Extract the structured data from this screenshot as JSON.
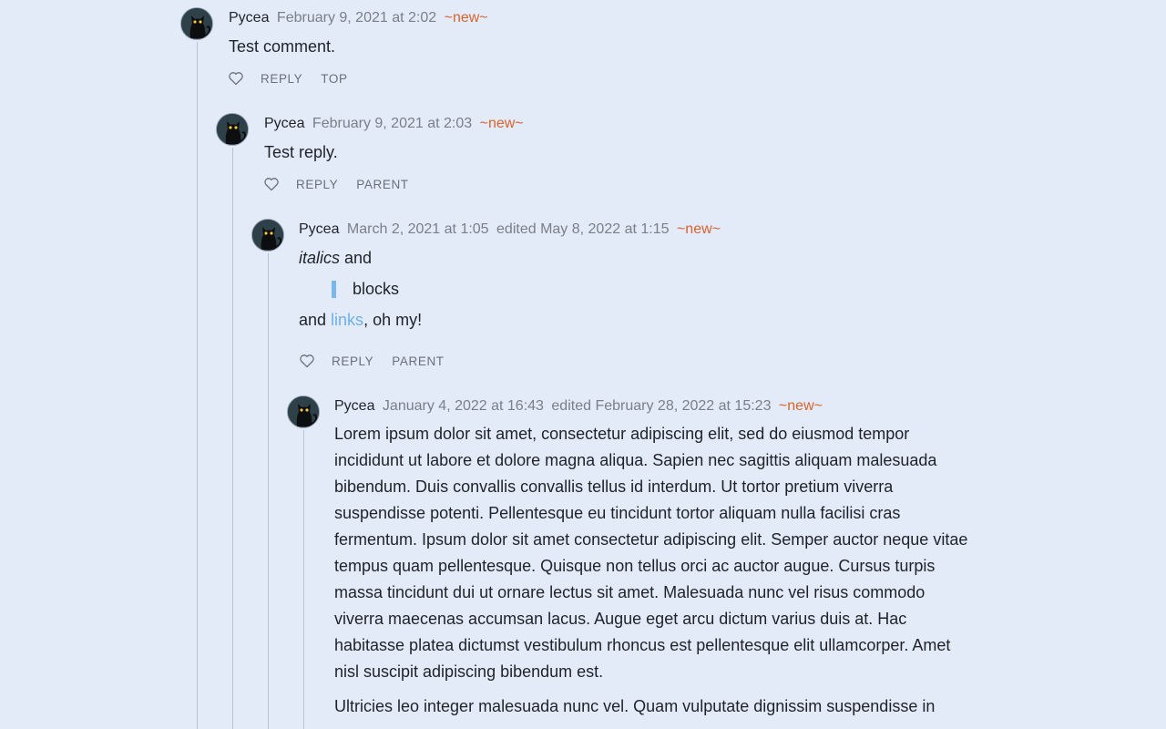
{
  "comments": [
    {
      "author": "Pycea",
      "date": "February 9, 2021 at 2:02",
      "edited": "",
      "new_tag": "~new~",
      "body": "Test comment.",
      "actions": [
        "REPLY",
        "TOP"
      ]
    },
    {
      "author": "Pycea",
      "date": "February 9, 2021 at 2:03",
      "edited": "",
      "new_tag": "~new~",
      "body": "Test reply.",
      "actions": [
        "REPLY",
        "PARENT"
      ]
    },
    {
      "author": "Pycea",
      "date": "March 2, 2021 at 1:05",
      "edited": "edited May 8, 2022 at 1:15",
      "new_tag": "~new~",
      "body_italic": "italics",
      "body_and": " and",
      "quote": "blocks",
      "body_prefix": "and ",
      "link_text": "links",
      "body_suffix": ", oh my!",
      "actions": [
        "REPLY",
        "PARENT"
      ]
    },
    {
      "author": "Pycea",
      "date": "January 4, 2022 at 16:43",
      "edited": "edited February 28, 2022 at 15:23",
      "new_tag": "~new~",
      "paragraphs": [
        "Lorem ipsum dolor sit amet, consectetur adipiscing elit, sed do eiusmod tempor incididunt ut labore et dolore magna aliqua. Sapien nec sagittis aliquam malesuada bibendum. Duis convallis convallis tellus id interdum. Ut tortor pretium viverra suspendisse potenti. Pellentesque eu tincidunt tortor aliquam nulla facilisi cras fermentum. Ipsum dolor sit amet consectetur adipiscing elit. Semper auctor neque vitae tempus quam pellentesque. Quisque non tellus orci ac auctor augue. Cursus turpis massa tincidunt dui ut ornare lectus sit amet. Malesuada nunc vel risus commodo viverra maecenas accumsan lacus. Augue eget arcu dictum varius duis at. Hac habitasse platea dictumst vestibulum rhoncus est pellentesque elit ullamcorper. Amet nisl suscipit adipiscing bibendum est.",
        "Ultricies leo integer malesuada nunc vel. Quam vulputate dignissim suspendisse in"
      ]
    }
  ],
  "colors": {
    "background": "#e3ebf9",
    "new_tag": "#d8622c",
    "link": "#6fb0e6",
    "quote_bar": "#7ab8ea",
    "thread_line": "#b8c2d3"
  },
  "icons": {
    "avatar": "black-cat-avatar",
    "like": "heart-outline-icon"
  }
}
